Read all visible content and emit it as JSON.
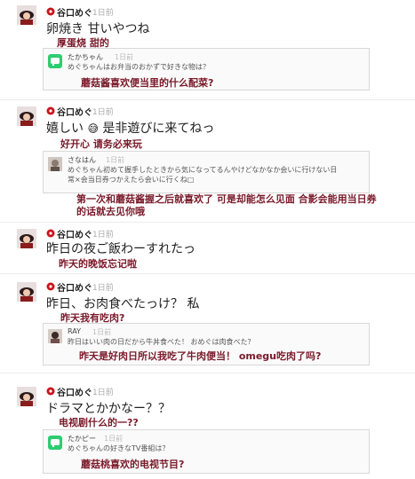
{
  "colors": {
    "accent_pin": "#c8141e",
    "translation": "#7a1a2a",
    "link": "#3b5998"
  },
  "author": "谷口めぐ",
  "posts": [
    {
      "time": "1日前",
      "text": "卵焼き 甘いやつね",
      "translation": "厚蛋烧 甜的",
      "quote": {
        "name": "たかちゃん",
        "time": "1日前",
        "avatar": "app-icon",
        "lines": [
          "めぐちゃんはお弁当のおかずで好きな物は？"
        ],
        "translation": "蘑菇酱喜欢便当里的什么配菜?"
      }
    },
    {
      "time": "1日前",
      "text": "嬉しい",
      "emoji": "😅",
      "text2": "是非遊びに来てねっ",
      "translation": "好开心 请务必来玩",
      "quote": {
        "name": "さなはん",
        "time": "1日前",
        "avatar": "photo",
        "lines": [
          "めぐちゃん初めて握手したときから気になってるんやけどなかなか会いに行けない日",
          "常×会当日券つかえたら会いに行くね□"
        ],
        "translation": "第一次和蘑菇酱握之后就喜欢了 可是却能怎么见面 合影会能用当日券",
        "translation2": "的话就去见你哦"
      }
    },
    {
      "time": "1日前",
      "text": "昨日の夜ご飯わーすれたっ",
      "translation": "昨天的晚饭忘记啦"
    },
    {
      "time": "1日前",
      "text": "昨日、お肉食べたっけ？ 私",
      "translation": "昨天我有吃肉?",
      "quote": {
        "name": "RAY",
        "time": "1日前",
        "avatar": "photo",
        "lines": [
          "昨日はいい肉の日だから牛丼食べた！ おめぐは肉食べた？"
        ],
        "translation": "昨天是好肉日所以我吃了牛肉便当！ omegu吃肉了吗?"
      }
    },
    {
      "time": "1日前",
      "text": "ドラマとかかなー？？",
      "translation": "电视剧什么的一??",
      "quote": {
        "name": "たかピー",
        "time": "1日前",
        "avatar": "app-icon",
        "lines": [
          "めぐちゃんの好きなTV番組は？"
        ],
        "translation": "蘑菇桃喜欢的电视节目?"
      }
    }
  ]
}
